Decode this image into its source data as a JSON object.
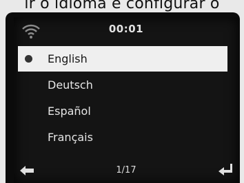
{
  "caption": "ir o idioma e configurar o",
  "status": {
    "time": "00:01",
    "wifi_icon": "wifi-icon"
  },
  "languages": [
    {
      "label": "English",
      "selected": true
    },
    {
      "label": "Deutsch"
    },
    {
      "label": "Español"
    },
    {
      "label": "Français"
    }
  ],
  "footer": {
    "page": "1/17",
    "back_icon": "back-arrow-icon",
    "enter_icon": "enter-return-icon"
  },
  "colors": {
    "screen": "#141414",
    "highlight": "#efefef",
    "text": "#e6e6e6"
  }
}
